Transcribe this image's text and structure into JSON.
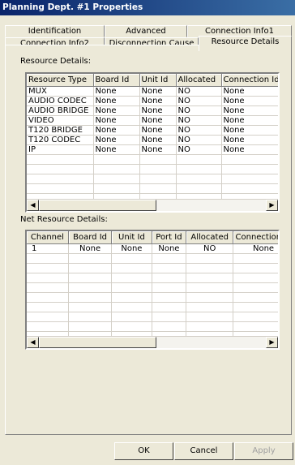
{
  "window": {
    "title": "Planning Dept. #1 Properties"
  },
  "tabs": {
    "row_back": [
      "Identification",
      "Advanced",
      "Connection Info1"
    ],
    "row_front": [
      "Connection Info2",
      "Disconnection Cause",
      "Resource Details"
    ],
    "active": "Resource Details"
  },
  "resource_details": {
    "label": "Resource Details:",
    "columns": [
      "Resource Type",
      "Board Id",
      "Unit Id",
      "Allocated",
      "Connection Id"
    ],
    "rows": [
      [
        "MUX",
        "None",
        "None",
        "NO",
        "None"
      ],
      [
        "AUDIO CODEC",
        "None",
        "None",
        "NO",
        "None"
      ],
      [
        "AUDIO BRIDGE",
        "None",
        "None",
        "NO",
        "None"
      ],
      [
        "VIDEO",
        "None",
        "None",
        "NO",
        "None"
      ],
      [
        "T120 BRIDGE",
        "None",
        "None",
        "NO",
        "None"
      ],
      [
        "T120 CODEC",
        "None",
        "None",
        "NO",
        "None"
      ],
      [
        "IP",
        "None",
        "None",
        "NO",
        "None"
      ]
    ]
  },
  "net_resource_details": {
    "label": "Net Resource Details:",
    "columns": [
      "Channel",
      "Board Id",
      "Unit Id",
      "Port Id",
      "Allocated",
      "Connection Id"
    ],
    "rows": [
      [
        "1",
        "None",
        "None",
        "None",
        "NO",
        "None"
      ]
    ]
  },
  "buttons": {
    "ok": "OK",
    "cancel": "Cancel",
    "apply": "Apply"
  }
}
